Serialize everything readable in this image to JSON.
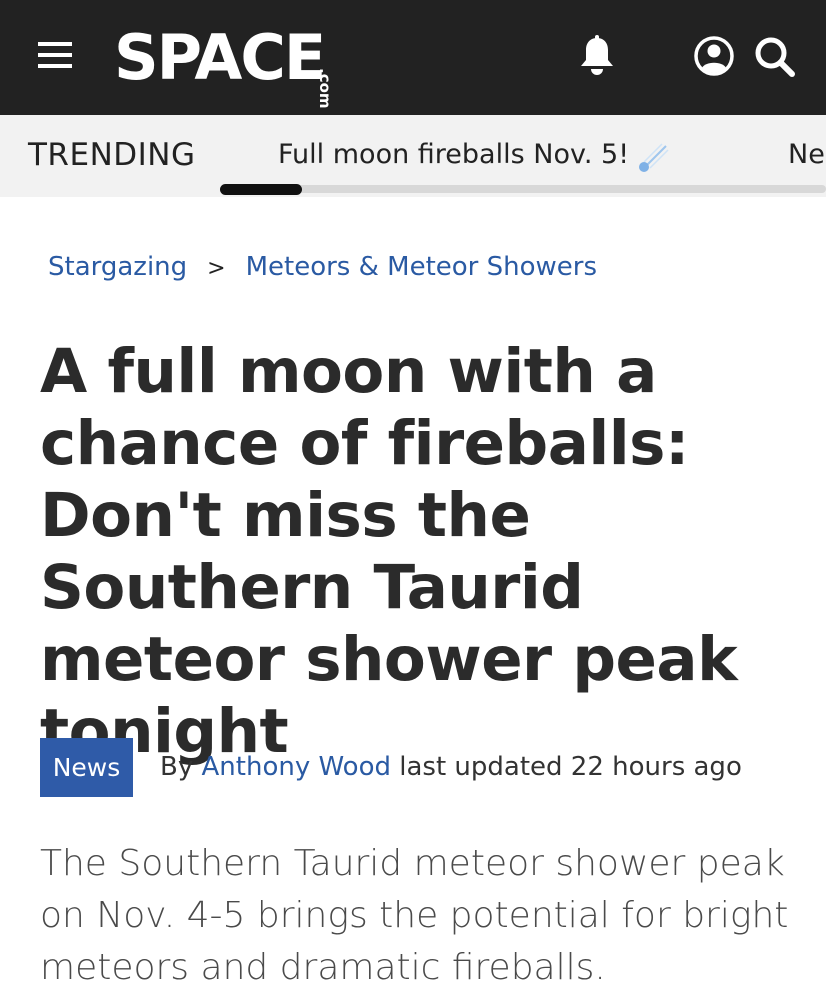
{
  "header": {
    "logo_text": "SPACE",
    "logo_suffix": ".com",
    "icons": [
      "menu-icon",
      "bell-icon",
      "account-icon",
      "search-icon"
    ],
    "background_color": "#222222"
  },
  "trending": {
    "label": "TRENDING",
    "items": [
      {
        "label": "Full moon fireballs Nov. 5!",
        "icon": "comet-icon"
      },
      {
        "label": "Ne"
      }
    ]
  },
  "breadcrumb": {
    "items": [
      "Stargazing",
      "Meteors & Meteor Showers"
    ],
    "separator": ">"
  },
  "article": {
    "headline": "A full moon with a chance of fireballs: Don't miss the Southern Taurid meteor shower peak tonight",
    "badge": "News",
    "by_prefix": "By",
    "author": "Anthony Wood",
    "updated": "last updated 22 hours ago",
    "standfirst": "The Southern Taurid meteor shower peak on Nov. 4-5 brings the potential for bright meteors and dramatic fireballs."
  },
  "colors": {
    "link": "#2a5aa3",
    "badge": "#2f5ba8",
    "headline": "#2b2b2b"
  }
}
